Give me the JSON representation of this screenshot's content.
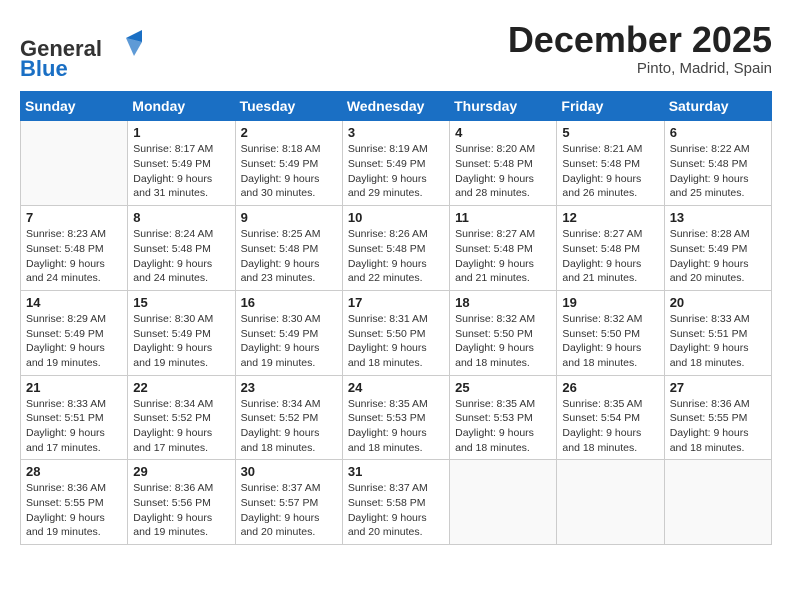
{
  "header": {
    "logo_line1": "General",
    "logo_line2": "Blue",
    "month": "December 2025",
    "location": "Pinto, Madrid, Spain"
  },
  "weekdays": [
    "Sunday",
    "Monday",
    "Tuesday",
    "Wednesday",
    "Thursday",
    "Friday",
    "Saturday"
  ],
  "weeks": [
    [
      {
        "day": "",
        "info": ""
      },
      {
        "day": "1",
        "info": "Sunrise: 8:17 AM\nSunset: 5:49 PM\nDaylight: 9 hours\nand 31 minutes."
      },
      {
        "day": "2",
        "info": "Sunrise: 8:18 AM\nSunset: 5:49 PM\nDaylight: 9 hours\nand 30 minutes."
      },
      {
        "day": "3",
        "info": "Sunrise: 8:19 AM\nSunset: 5:49 PM\nDaylight: 9 hours\nand 29 minutes."
      },
      {
        "day": "4",
        "info": "Sunrise: 8:20 AM\nSunset: 5:48 PM\nDaylight: 9 hours\nand 28 minutes."
      },
      {
        "day": "5",
        "info": "Sunrise: 8:21 AM\nSunset: 5:48 PM\nDaylight: 9 hours\nand 26 minutes."
      },
      {
        "day": "6",
        "info": "Sunrise: 8:22 AM\nSunset: 5:48 PM\nDaylight: 9 hours\nand 25 minutes."
      }
    ],
    [
      {
        "day": "7",
        "info": "Sunrise: 8:23 AM\nSunset: 5:48 PM\nDaylight: 9 hours\nand 24 minutes."
      },
      {
        "day": "8",
        "info": "Sunrise: 8:24 AM\nSunset: 5:48 PM\nDaylight: 9 hours\nand 24 minutes."
      },
      {
        "day": "9",
        "info": "Sunrise: 8:25 AM\nSunset: 5:48 PM\nDaylight: 9 hours\nand 23 minutes."
      },
      {
        "day": "10",
        "info": "Sunrise: 8:26 AM\nSunset: 5:48 PM\nDaylight: 9 hours\nand 22 minutes."
      },
      {
        "day": "11",
        "info": "Sunrise: 8:27 AM\nSunset: 5:48 PM\nDaylight: 9 hours\nand 21 minutes."
      },
      {
        "day": "12",
        "info": "Sunrise: 8:27 AM\nSunset: 5:48 PM\nDaylight: 9 hours\nand 21 minutes."
      },
      {
        "day": "13",
        "info": "Sunrise: 8:28 AM\nSunset: 5:49 PM\nDaylight: 9 hours\nand 20 minutes."
      }
    ],
    [
      {
        "day": "14",
        "info": "Sunrise: 8:29 AM\nSunset: 5:49 PM\nDaylight: 9 hours\nand 19 minutes."
      },
      {
        "day": "15",
        "info": "Sunrise: 8:30 AM\nSunset: 5:49 PM\nDaylight: 9 hours\nand 19 minutes."
      },
      {
        "day": "16",
        "info": "Sunrise: 8:30 AM\nSunset: 5:49 PM\nDaylight: 9 hours\nand 19 minutes."
      },
      {
        "day": "17",
        "info": "Sunrise: 8:31 AM\nSunset: 5:50 PM\nDaylight: 9 hours\nand 18 minutes."
      },
      {
        "day": "18",
        "info": "Sunrise: 8:32 AM\nSunset: 5:50 PM\nDaylight: 9 hours\nand 18 minutes."
      },
      {
        "day": "19",
        "info": "Sunrise: 8:32 AM\nSunset: 5:50 PM\nDaylight: 9 hours\nand 18 minutes."
      },
      {
        "day": "20",
        "info": "Sunrise: 8:33 AM\nSunset: 5:51 PM\nDaylight: 9 hours\nand 18 minutes."
      }
    ],
    [
      {
        "day": "21",
        "info": "Sunrise: 8:33 AM\nSunset: 5:51 PM\nDaylight: 9 hours\nand 17 minutes."
      },
      {
        "day": "22",
        "info": "Sunrise: 8:34 AM\nSunset: 5:52 PM\nDaylight: 9 hours\nand 17 minutes."
      },
      {
        "day": "23",
        "info": "Sunrise: 8:34 AM\nSunset: 5:52 PM\nDaylight: 9 hours\nand 18 minutes."
      },
      {
        "day": "24",
        "info": "Sunrise: 8:35 AM\nSunset: 5:53 PM\nDaylight: 9 hours\nand 18 minutes."
      },
      {
        "day": "25",
        "info": "Sunrise: 8:35 AM\nSunset: 5:53 PM\nDaylight: 9 hours\nand 18 minutes."
      },
      {
        "day": "26",
        "info": "Sunrise: 8:35 AM\nSunset: 5:54 PM\nDaylight: 9 hours\nand 18 minutes."
      },
      {
        "day": "27",
        "info": "Sunrise: 8:36 AM\nSunset: 5:55 PM\nDaylight: 9 hours\nand 18 minutes."
      }
    ],
    [
      {
        "day": "28",
        "info": "Sunrise: 8:36 AM\nSunset: 5:55 PM\nDaylight: 9 hours\nand 19 minutes."
      },
      {
        "day": "29",
        "info": "Sunrise: 8:36 AM\nSunset: 5:56 PM\nDaylight: 9 hours\nand 19 minutes."
      },
      {
        "day": "30",
        "info": "Sunrise: 8:37 AM\nSunset: 5:57 PM\nDaylight: 9 hours\nand 20 minutes."
      },
      {
        "day": "31",
        "info": "Sunrise: 8:37 AM\nSunset: 5:58 PM\nDaylight: 9 hours\nand 20 minutes."
      },
      {
        "day": "",
        "info": ""
      },
      {
        "day": "",
        "info": ""
      },
      {
        "day": "",
        "info": ""
      }
    ]
  ]
}
